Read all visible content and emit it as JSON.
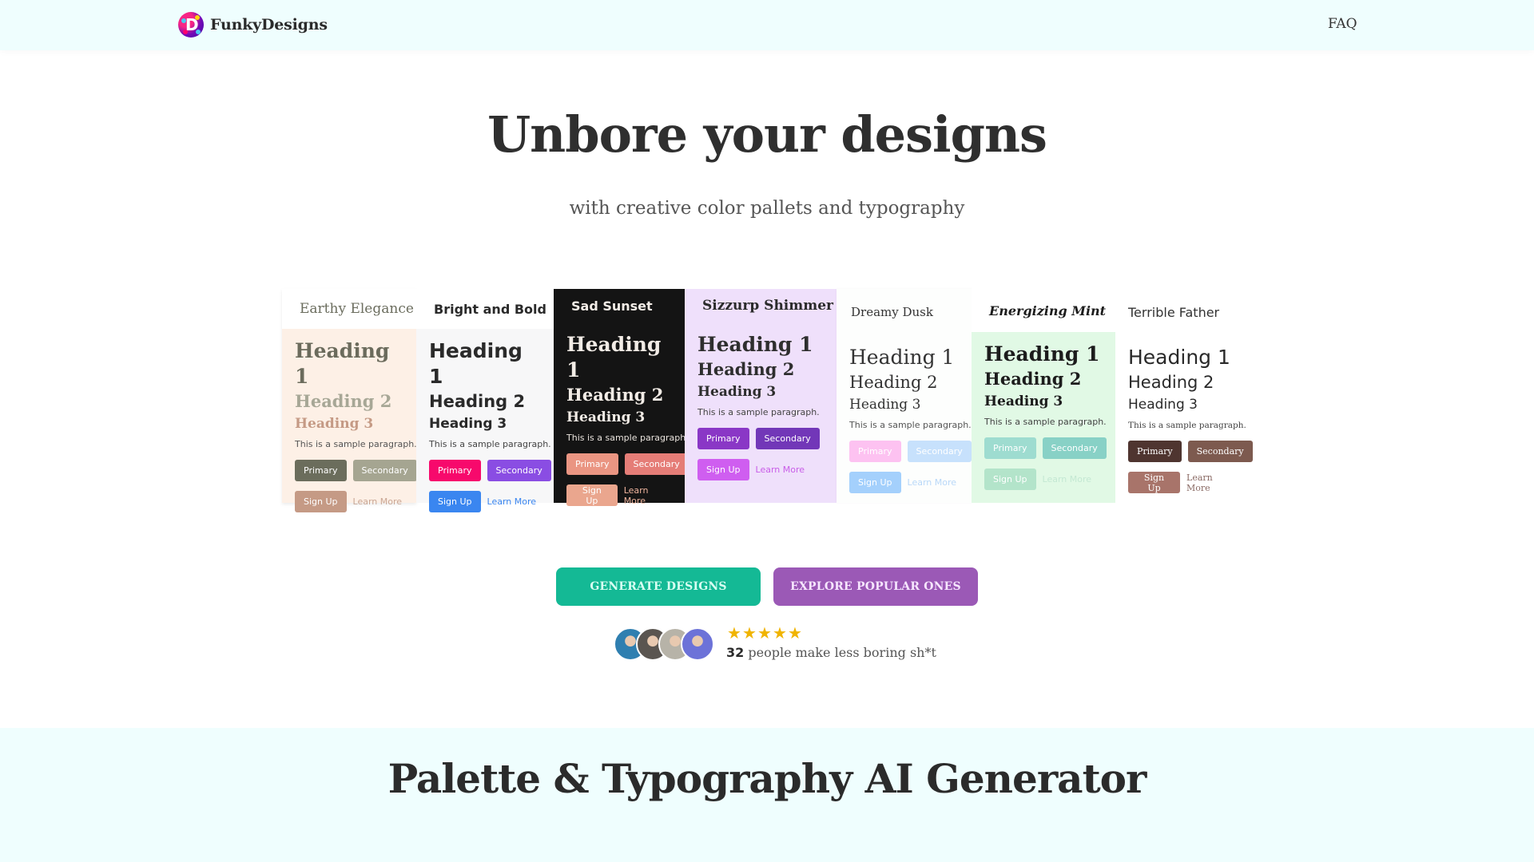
{
  "nav": {
    "brand": "FunkyDesigns",
    "links": [
      {
        "label": "FAQ"
      }
    ]
  },
  "hero": {
    "title": "Unbore your designs",
    "subtitle": "with creative color pallets and typography"
  },
  "samples": [
    {
      "name": "Earthy Elegance",
      "h1": "Heading 1",
      "h2": "Heading 2",
      "h3": "Heading 3",
      "paragraph": "This is a sample paragraph.",
      "primary": "Primary",
      "secondary": "Secondary",
      "signup": "Sign Up",
      "learn_more": "Learn More",
      "colors": {
        "primary": "#6b6d5c",
        "secondary": "#a5a591",
        "signup": "#c59a85",
        "link": "#c9a694"
      }
    },
    {
      "name": "Bright and Bold",
      "h1": "Heading 1",
      "h2": "Heading 2",
      "h3": "Heading 3",
      "paragraph": "This is a sample paragraph.",
      "primary": "Primary",
      "secondary": "Secondary",
      "signup": "Sign Up",
      "learn_more": "Learn More",
      "colors": {
        "primary": "#f7096c",
        "secondary": "#8a4de3",
        "signup": "#3a86f0",
        "link": "#3a86f0"
      }
    },
    {
      "name": "Sad Sunset",
      "h1": "Heading 1",
      "h2": "Heading 2",
      "h3": "Heading 3",
      "paragraph": "This is a sample paragraph.",
      "primary": "Primary",
      "secondary": "Secondary",
      "signup": "Sign Up",
      "learn_more": "Learn More",
      "colors": {
        "primary": "#ea9582",
        "secondary": "#e57d77",
        "signup": "#eaa68e",
        "link": "#efb49e"
      }
    },
    {
      "name": "Sizzurp Shimmer",
      "h1": "Heading 1",
      "h2": "Heading 2",
      "h3": "Heading 3",
      "paragraph": "This is a sample paragraph.",
      "primary": "Primary",
      "secondary": "Secondary",
      "signup": "Sign Up",
      "learn_more": "Learn More",
      "colors": {
        "primary": "#8a37c6",
        "secondary": "#7237b8",
        "signup": "#cf5ef0",
        "link": "#c95de8"
      }
    },
    {
      "name": "Dreamy Dusk",
      "h1": "Heading 1",
      "h2": "Heading 2",
      "h3": "Heading 3",
      "paragraph": "This is a sample paragraph.",
      "primary": "Primary",
      "secondary": "Secondary",
      "signup": "Sign Up",
      "learn_more": "Learn More",
      "colors": {
        "primary": "#fdc2f1",
        "secondary": "#c7e1fc",
        "signup": "#a4d0fc",
        "link": "#b9d8f8"
      }
    },
    {
      "name": "Energizing Mint",
      "h1": "Heading 1",
      "h2": "Heading 2",
      "h3": "Heading 3",
      "paragraph": "This is a sample paragraph.",
      "primary": "Primary",
      "secondary": "Secondary",
      "signup": "Sign Up",
      "learn_more": "Learn More",
      "colors": {
        "primary": "#9edcd0",
        "secondary": "#88d1c6",
        "signup": "#b3e4ca",
        "link": "#c4e8d3"
      }
    },
    {
      "name": "Terrible Father",
      "h1": "Heading 1",
      "h2": "Heading 2",
      "h3": "Heading 3",
      "paragraph": "This is a sample paragraph.",
      "primary": "Primary",
      "secondary": "Secondary",
      "signup": "Sign Up",
      "learn_more": "Learn More",
      "colors": {
        "primary": "#4f3530",
        "secondary": "#7d5a4f",
        "signup": "#a8746a",
        "link": "#8a6a64"
      }
    }
  ],
  "cta": {
    "generate": "GENERATE DESIGNS",
    "explore": "EXPLORE POPULAR ONES"
  },
  "social_proof": {
    "rating": 5,
    "rating_max": 5,
    "count": "32",
    "text": "people make less boring sh*t",
    "avatars": [
      {
        "name": "user-avatar-1",
        "color": "#2f7fb0"
      },
      {
        "name": "user-avatar-2",
        "color": "#5a5550"
      },
      {
        "name": "user-avatar-3",
        "color": "#b7b3a8"
      },
      {
        "name": "user-avatar-4",
        "color": "#6c72d8"
      }
    ]
  },
  "section2": {
    "title": "Palette & Typography AI Generator"
  }
}
